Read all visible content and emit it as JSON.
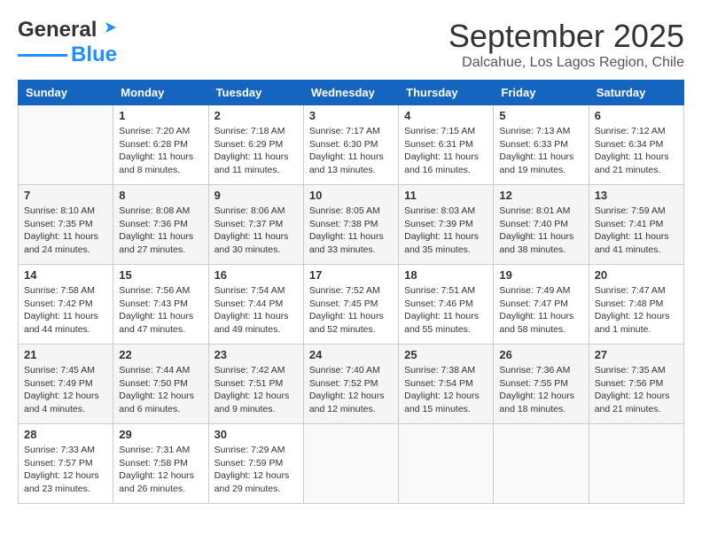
{
  "logo": {
    "line1": "General",
    "line2": "Blue"
  },
  "title": "September 2025",
  "location": "Dalcahue, Los Lagos Region, Chile",
  "days_of_week": [
    "Sunday",
    "Monday",
    "Tuesday",
    "Wednesday",
    "Thursday",
    "Friday",
    "Saturday"
  ],
  "weeks": [
    [
      {
        "day": "",
        "info": ""
      },
      {
        "day": "1",
        "info": "Sunrise: 7:20 AM\nSunset: 6:28 PM\nDaylight: 11 hours\nand 8 minutes."
      },
      {
        "day": "2",
        "info": "Sunrise: 7:18 AM\nSunset: 6:29 PM\nDaylight: 11 hours\nand 11 minutes."
      },
      {
        "day": "3",
        "info": "Sunrise: 7:17 AM\nSunset: 6:30 PM\nDaylight: 11 hours\nand 13 minutes."
      },
      {
        "day": "4",
        "info": "Sunrise: 7:15 AM\nSunset: 6:31 PM\nDaylight: 11 hours\nand 16 minutes."
      },
      {
        "day": "5",
        "info": "Sunrise: 7:13 AM\nSunset: 6:33 PM\nDaylight: 11 hours\nand 19 minutes."
      },
      {
        "day": "6",
        "info": "Sunrise: 7:12 AM\nSunset: 6:34 PM\nDaylight: 11 hours\nand 21 minutes."
      }
    ],
    [
      {
        "day": "7",
        "info": ""
      },
      {
        "day": "8",
        "info": "Sunrise: 8:08 AM\nSunset: 7:36 PM\nDaylight: 11 hours\nand 27 minutes."
      },
      {
        "day": "9",
        "info": "Sunrise: 8:06 AM\nSunset: 7:37 PM\nDaylight: 11 hours\nand 30 minutes."
      },
      {
        "day": "10",
        "info": "Sunrise: 8:05 AM\nSunset: 7:38 PM\nDaylight: 11 hours\nand 33 minutes."
      },
      {
        "day": "11",
        "info": "Sunrise: 8:03 AM\nSunset: 7:39 PM\nDaylight: 11 hours\nand 35 minutes."
      },
      {
        "day": "12",
        "info": "Sunrise: 8:01 AM\nSunset: 7:40 PM\nDaylight: 11 hours\nand 38 minutes."
      },
      {
        "day": "13",
        "info": "Sunrise: 7:59 AM\nSunset: 7:41 PM\nDaylight: 11 hours\nand 41 minutes."
      }
    ],
    [
      {
        "day": "14",
        "info": ""
      },
      {
        "day": "15",
        "info": "Sunrise: 7:56 AM\nSunset: 7:43 PM\nDaylight: 11 hours\nand 47 minutes."
      },
      {
        "day": "16",
        "info": "Sunrise: 7:54 AM\nSunset: 7:44 PM\nDaylight: 11 hours\nand 49 minutes."
      },
      {
        "day": "17",
        "info": "Sunrise: 7:52 AM\nSunset: 7:45 PM\nDaylight: 11 hours\nand 52 minutes."
      },
      {
        "day": "18",
        "info": "Sunrise: 7:51 AM\nSunset: 7:46 PM\nDaylight: 11 hours\nand 55 minutes."
      },
      {
        "day": "19",
        "info": "Sunrise: 7:49 AM\nSunset: 7:47 PM\nDaylight: 11 hours\nand 58 minutes."
      },
      {
        "day": "20",
        "info": "Sunrise: 7:47 AM\nSunset: 7:48 PM\nDaylight: 12 hours\nand 1 minute."
      }
    ],
    [
      {
        "day": "21",
        "info": ""
      },
      {
        "day": "22",
        "info": "Sunrise: 7:44 AM\nSunset: 7:50 PM\nDaylight: 12 hours\nand 6 minutes."
      },
      {
        "day": "23",
        "info": "Sunrise: 7:42 AM\nSunset: 7:51 PM\nDaylight: 12 hours\nand 9 minutes."
      },
      {
        "day": "24",
        "info": "Sunrise: 7:40 AM\nSunset: 7:52 PM\nDaylight: 12 hours\nand 12 minutes."
      },
      {
        "day": "25",
        "info": "Sunrise: 7:38 AM\nSunset: 7:54 PM\nDaylight: 12 hours\nand 15 minutes."
      },
      {
        "day": "26",
        "info": "Sunrise: 7:36 AM\nSunset: 7:55 PM\nDaylight: 12 hours\nand 18 minutes."
      },
      {
        "day": "27",
        "info": "Sunrise: 7:35 AM\nSunset: 7:56 PM\nDaylight: 12 hours\nand 21 minutes."
      }
    ],
    [
      {
        "day": "28",
        "info": ""
      },
      {
        "day": "29",
        "info": "Sunrise: 7:31 AM\nSunset: 7:58 PM\nDaylight: 12 hours\nand 26 minutes."
      },
      {
        "day": "30",
        "info": "Sunrise: 7:29 AM\nSunset: 7:59 PM\nDaylight: 12 hours\nand 29 minutes."
      },
      {
        "day": "",
        "info": ""
      },
      {
        "day": "",
        "info": ""
      },
      {
        "day": "",
        "info": ""
      },
      {
        "day": "",
        "info": ""
      }
    ]
  ],
  "week1_day7_info": "Sunrise: 8:10 AM\nSunset: 7:35 PM\nDaylight: 11 hours\nand 24 minutes.",
  "week3_day14_info": "Sunrise: 7:58 AM\nSunset: 7:42 PM\nDaylight: 11 hours\nand 44 minutes.",
  "week4_day21_info": "Sunrise: 7:45 AM\nSunset: 7:49 PM\nDaylight: 12 hours\nand 4 minutes.",
  "week5_day28_info": "Sunrise: 7:33 AM\nSunset: 7:57 PM\nDaylight: 12 hours\nand 23 minutes."
}
